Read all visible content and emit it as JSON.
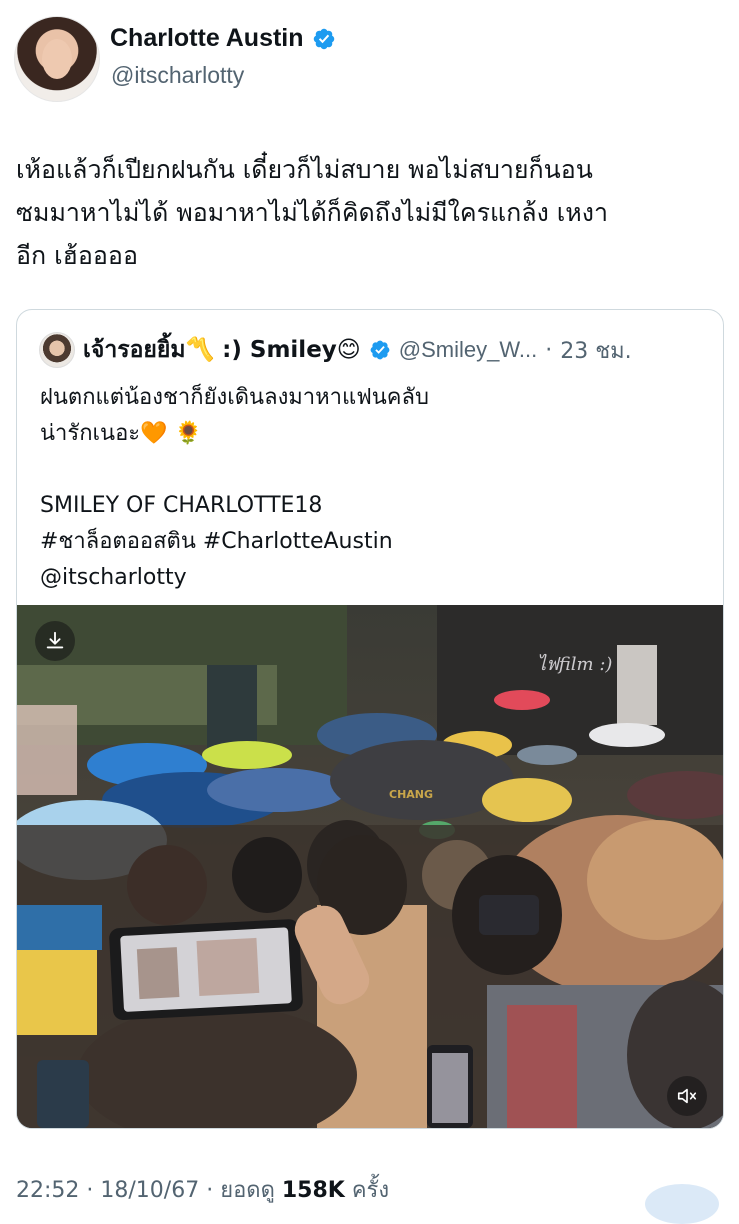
{
  "author": {
    "display_name": "Charlotte Austin",
    "handle": "@itscharlotty",
    "verified_icon": "verified-badge-icon",
    "verified_color": "#1d9bf0"
  },
  "tweet": {
    "text": "เห้อแล้วก็เปียกฝนกัน เดี๋ยวก็ไม่สบาย พอไม่สบายก็นอน\nซมมาหาไม่ได้ พอมาหาไม่ได้ก็คิดถึงไม่มีใครแกล้ง เหงา\nอีก เฮ้ออออ"
  },
  "quote": {
    "display_name": "เจ้ารอยยิ้ม〽️ :) Smiley😊",
    "handle": "@Smiley_W...",
    "separator": "·",
    "time": "23 ชม.",
    "text": "ฝนตกแต่น้องชาก็ยังเดินลงมาหาแฟนคลับ\nน่ารักเนอะ🧡 🌻\n\nSMILEY OF CHARLOTTE18\n#ชาล็อตออสติน #CharlotteAustin\n@itscharlotty",
    "media": {
      "type": "video",
      "watermark": "ไฟfilm :)",
      "umbrella_text": "CHANG"
    }
  },
  "footer": {
    "time": "22:52",
    "sep1": " · ",
    "date": "18/10/67",
    "sep2": " · ",
    "views_label": "ยอดดู ",
    "views_count": "158K",
    "views_unit": " ครั้ง"
  },
  "colors": {
    "text_primary": "#0f1419",
    "text_secondary": "#536471",
    "border": "#cfd9de"
  }
}
